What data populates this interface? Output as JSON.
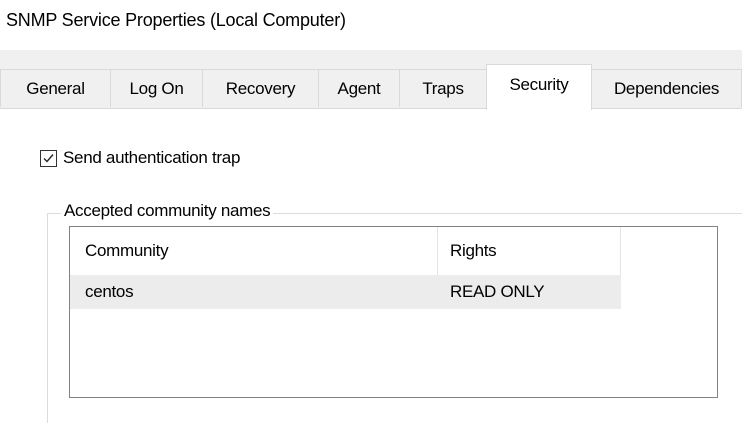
{
  "window": {
    "title": "SNMP Service Properties (Local Computer)"
  },
  "tabs": [
    {
      "label": "General"
    },
    {
      "label": "Log On"
    },
    {
      "label": "Recovery"
    },
    {
      "label": "Agent"
    },
    {
      "label": "Traps"
    },
    {
      "label": "Security",
      "selected": true
    },
    {
      "label": "Dependencies"
    }
  ],
  "security": {
    "send_auth_trap_label": "Send authentication trap",
    "send_auth_trap_checked": true,
    "accepted_group_label": "Accepted community names",
    "columns": [
      "Community",
      "Rights"
    ],
    "rows": [
      {
        "community": "centos",
        "rights": "READ ONLY"
      }
    ]
  }
}
